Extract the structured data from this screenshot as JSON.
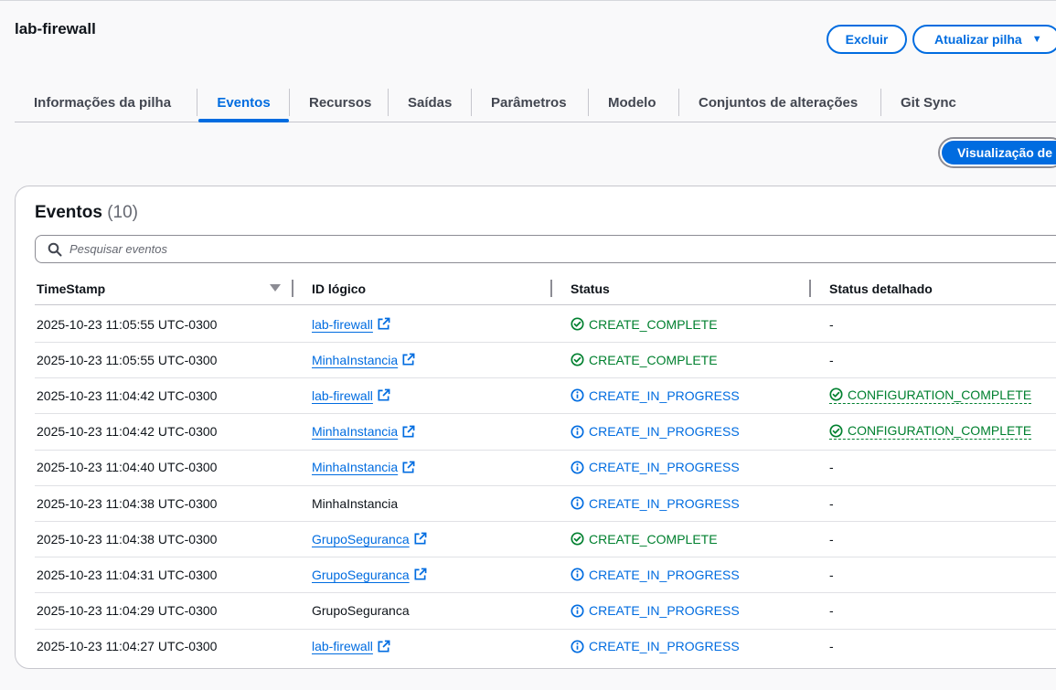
{
  "stack": {
    "title": "lab-firewall"
  },
  "header_buttons": {
    "delete": "Excluir",
    "update": "Atualizar pilha"
  },
  "tabs": [
    {
      "label": "Informações da pilha",
      "active": false
    },
    {
      "label": "Eventos",
      "active": true
    },
    {
      "label": "Recursos",
      "active": false
    },
    {
      "label": "Saídas",
      "active": false
    },
    {
      "label": "Parâmetros",
      "active": false
    },
    {
      "label": "Modelo",
      "active": false
    },
    {
      "label": "Conjuntos de alterações",
      "active": false
    },
    {
      "label": "Git Sync",
      "active": false
    }
  ],
  "view_button": "Visualização de",
  "events": {
    "title": "Eventos",
    "count": "(10)",
    "search_placeholder": "Pesquisar eventos",
    "columns": {
      "timestamp": "TimeStamp",
      "logical_id": "ID lógico",
      "status": "Status",
      "status_detail": "Status detalhado"
    },
    "rows": [
      {
        "timestamp": "2025-10-23 11:05:55 UTC-0300",
        "logical_id": "lab-firewall",
        "id_link": true,
        "status": "CREATE_COMPLETE",
        "status_kind": "complete",
        "detail": "-",
        "detail_kind": "none"
      },
      {
        "timestamp": "2025-10-23 11:05:55 UTC-0300",
        "logical_id": "MinhaInstancia",
        "id_link": true,
        "status": "CREATE_COMPLETE",
        "status_kind": "complete",
        "detail": "-",
        "detail_kind": "none"
      },
      {
        "timestamp": "2025-10-23 11:04:42 UTC-0300",
        "logical_id": "lab-firewall",
        "id_link": true,
        "status": "CREATE_IN_PROGRESS",
        "status_kind": "in-progress",
        "detail": "CONFIGURATION_COMPLETE",
        "detail_kind": "complete"
      },
      {
        "timestamp": "2025-10-23 11:04:42 UTC-0300",
        "logical_id": "MinhaInstancia",
        "id_link": true,
        "status": "CREATE_IN_PROGRESS",
        "status_kind": "in-progress",
        "detail": "CONFIGURATION_COMPLETE",
        "detail_kind": "complete"
      },
      {
        "timestamp": "2025-10-23 11:04:40 UTC-0300",
        "logical_id": "MinhaInstancia",
        "id_link": true,
        "status": "CREATE_IN_PROGRESS",
        "status_kind": "in-progress",
        "detail": "-",
        "detail_kind": "none"
      },
      {
        "timestamp": "2025-10-23 11:04:38 UTC-0300",
        "logical_id": "MinhaInstancia",
        "id_link": false,
        "status": "CREATE_IN_PROGRESS",
        "status_kind": "in-progress",
        "detail": "-",
        "detail_kind": "none"
      },
      {
        "timestamp": "2025-10-23 11:04:38 UTC-0300",
        "logical_id": "GrupoSeguranca",
        "id_link": true,
        "status": "CREATE_COMPLETE",
        "status_kind": "complete",
        "detail": "-",
        "detail_kind": "none"
      },
      {
        "timestamp": "2025-10-23 11:04:31 UTC-0300",
        "logical_id": "GrupoSeguranca",
        "id_link": true,
        "status": "CREATE_IN_PROGRESS",
        "status_kind": "in-progress",
        "detail": "-",
        "detail_kind": "none"
      },
      {
        "timestamp": "2025-10-23 11:04:29 UTC-0300",
        "logical_id": "GrupoSeguranca",
        "id_link": false,
        "status": "CREATE_IN_PROGRESS",
        "status_kind": "in-progress",
        "detail": "-",
        "detail_kind": "none"
      },
      {
        "timestamp": "2025-10-23 11:04:27 UTC-0300",
        "logical_id": "lab-firewall",
        "id_link": true,
        "status": "CREATE_IN_PROGRESS",
        "status_kind": "in-progress",
        "detail": "-",
        "detail_kind": "none"
      }
    ]
  },
  "colors": {
    "accent": "#006ce0",
    "success": "#00802f",
    "text": "#0f141a",
    "muted": "#656871"
  },
  "icons": {
    "search": "search-icon",
    "external": "external-link-icon",
    "complete": "check-circle-icon",
    "in_progress": "info-circle-icon",
    "sort": "sort-down-icon",
    "caret": "caret-down-icon"
  }
}
